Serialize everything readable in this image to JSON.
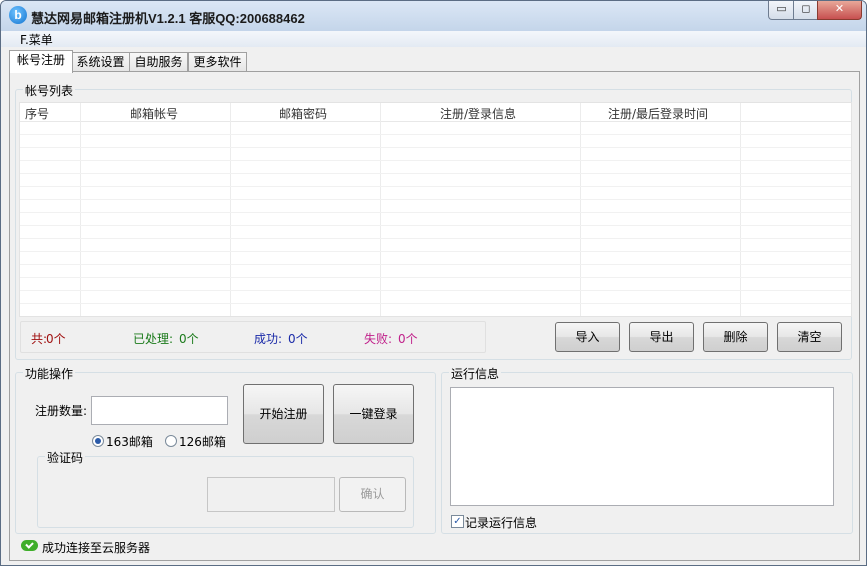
{
  "window": {
    "title": "慧达网易邮箱注册机V1.2.1 客服QQ:200688462",
    "icon": "app-logo-icon",
    "controls": {
      "minimize": "▭",
      "maximize": "◻",
      "close": "✕"
    }
  },
  "menu": {
    "item": "F.菜单"
  },
  "tabs": [
    "帐号注册",
    "系统设置",
    "自助服务",
    "更多软件"
  ],
  "account_list": {
    "group_label": "帐号列表",
    "columns": [
      "序号",
      "邮箱帐号",
      "邮箱密码",
      "注册/登录信息",
      "注册/最后登录时间"
    ],
    "rows": []
  },
  "counts": {
    "total_label": "共:",
    "total_value": "0个",
    "processed_label": "已处理:",
    "processed_value": "0个",
    "success_label": "成功:",
    "success_value": "0个",
    "failed_label": "失败:",
    "failed_value": "0个",
    "colors": {
      "total": "#a01010",
      "processed": "#1a7a1a",
      "success": "#1a2aa8",
      "failed": "#c0208a"
    }
  },
  "list_buttons": {
    "import": "导入",
    "export": "导出",
    "delete": "删除",
    "clear": "清空"
  },
  "operations": {
    "group_label": "功能操作",
    "count_label": "注册数量:",
    "count_value": "",
    "start_button": "开始注册",
    "login_button": "一键登录",
    "mail_options": [
      {
        "label": "163邮箱",
        "selected": true
      },
      {
        "label": "126邮箱",
        "selected": false
      }
    ],
    "captcha": {
      "group_label": "验证码",
      "input_value": "",
      "confirm_button": "确认"
    }
  },
  "run_info": {
    "group_label": "运行信息",
    "log_text": "",
    "record_label": "记录运行信息",
    "record_checked": true
  },
  "status": {
    "icon": "cloud-check-icon",
    "text": "成功连接至云服务器"
  }
}
